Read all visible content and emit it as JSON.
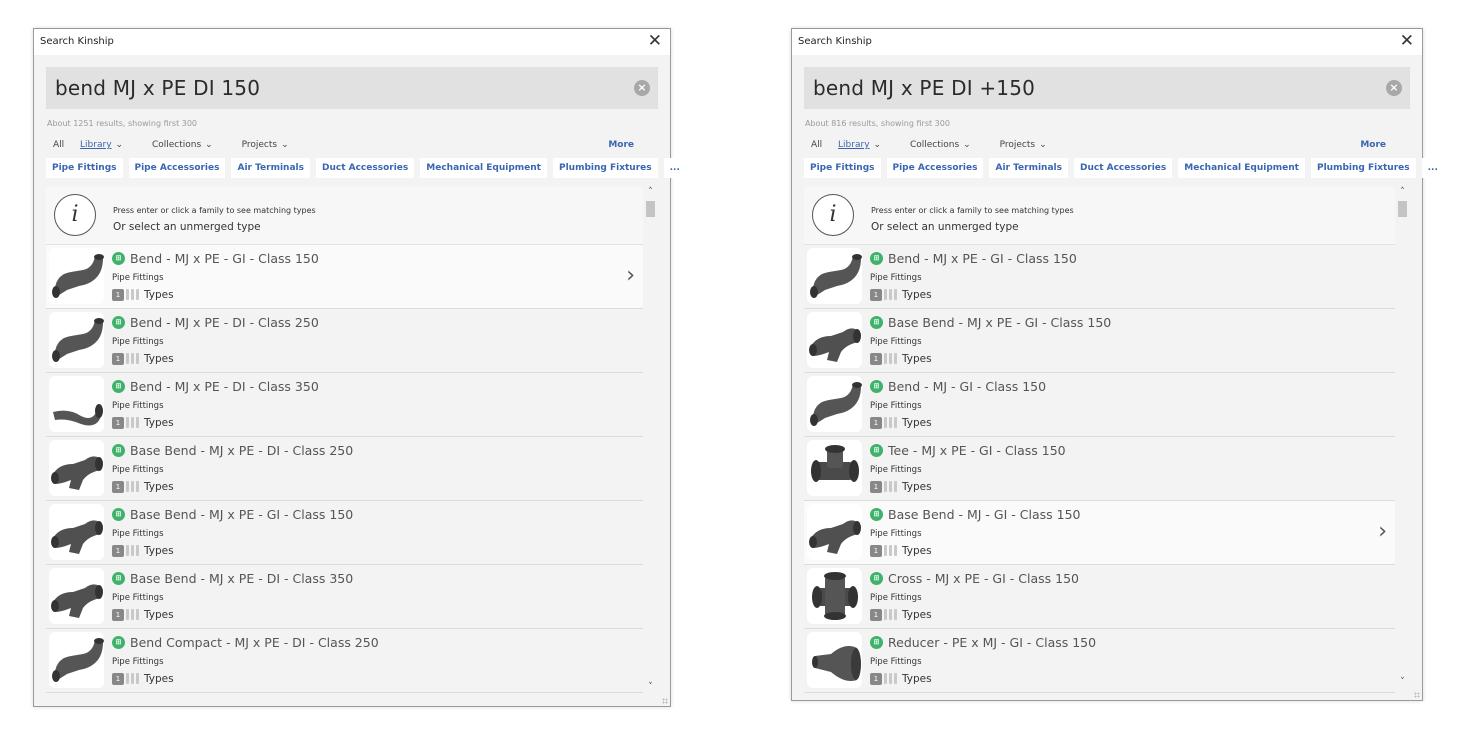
{
  "windows": [
    {
      "title": "Search Kinship",
      "query": "bend MJ x PE DI 150",
      "results_summary": "About 1251 results, showing first 300",
      "filters": [
        "All",
        "Library",
        "Collections",
        "Projects"
      ],
      "more_label": "More",
      "chips": [
        "Pipe Fittings",
        "Pipe Accessories",
        "Air Terminals",
        "Duct Accessories",
        "Mechanical Equipment",
        "Plumbing Fixtures",
        "..."
      ],
      "info_line1": "Press enter or click a family to see matching types",
      "info_line2": "Or select an unmerged type",
      "results": [
        {
          "name": "Bend - MJ x PE - GI - Class 150",
          "category": "Pipe Fittings",
          "count": "1",
          "types_label": "Types",
          "thumb": "bend"
        },
        {
          "name": "Bend - MJ x PE - DI - Class 250",
          "category": "Pipe Fittings",
          "count": "1",
          "types_label": "Types",
          "thumb": "bend"
        },
        {
          "name": "Bend - MJ x PE - DI - Class 350",
          "category": "Pipe Fittings",
          "count": "1",
          "types_label": "Types",
          "thumb": "bend-long"
        },
        {
          "name": "Base Bend - MJ x PE - DI - Class 250",
          "category": "Pipe Fittings",
          "count": "1",
          "types_label": "Types",
          "thumb": "base-bend"
        },
        {
          "name": "Base Bend - MJ x PE - GI - Class 150",
          "category": "Pipe Fittings",
          "count": "1",
          "types_label": "Types",
          "thumb": "base-bend"
        },
        {
          "name": "Base Bend - MJ x PE - DI - Class 350",
          "category": "Pipe Fittings",
          "count": "1",
          "types_label": "Types",
          "thumb": "base-bend"
        },
        {
          "name": "Bend Compact - MJ x PE - DI - Class 250",
          "category": "Pipe Fittings",
          "count": "1",
          "types_label": "Types",
          "thumb": "bend"
        }
      ]
    },
    {
      "title": "Search Kinship",
      "query": "bend MJ x PE DI +150",
      "results_summary": "About 816 results, showing first 300",
      "filters": [
        "All",
        "Library",
        "Collections",
        "Projects"
      ],
      "more_label": "More",
      "chips": [
        "Pipe Fittings",
        "Pipe Accessories",
        "Air Terminals",
        "Duct Accessories",
        "Mechanical Equipment",
        "Plumbing Fixtures",
        "..."
      ],
      "info_line1": "Press enter or click a family to see matching types",
      "info_line2": "Or select an unmerged type",
      "results": [
        {
          "name": "Bend - MJ x PE - GI - Class 150",
          "category": "Pipe Fittings",
          "count": "1",
          "types_label": "Types",
          "thumb": "bend"
        },
        {
          "name": "Base Bend - MJ x PE - GI - Class 150",
          "category": "Pipe Fittings",
          "count": "1",
          "types_label": "Types",
          "thumb": "base-bend"
        },
        {
          "name": "Bend - MJ - GI - Class 150",
          "category": "Pipe Fittings",
          "count": "1",
          "types_label": "Types",
          "thumb": "bend"
        },
        {
          "name": "Tee - MJ x PE - GI - Class 150",
          "category": "Pipe Fittings",
          "count": "1",
          "types_label": "Types",
          "thumb": "tee"
        },
        {
          "name": "Base Bend - MJ - GI - Class 150",
          "category": "Pipe Fittings",
          "count": "1",
          "types_label": "Types",
          "thumb": "base-bend"
        },
        {
          "name": "Cross - MJ x PE - GI - Class 150",
          "category": "Pipe Fittings",
          "count": "1",
          "types_label": "Types",
          "thumb": "cross"
        },
        {
          "name": "Reducer - PE x MJ - GI - Class 150",
          "category": "Pipe Fittings",
          "count": "1",
          "types_label": "Types",
          "thumb": "reducer"
        }
      ]
    }
  ]
}
